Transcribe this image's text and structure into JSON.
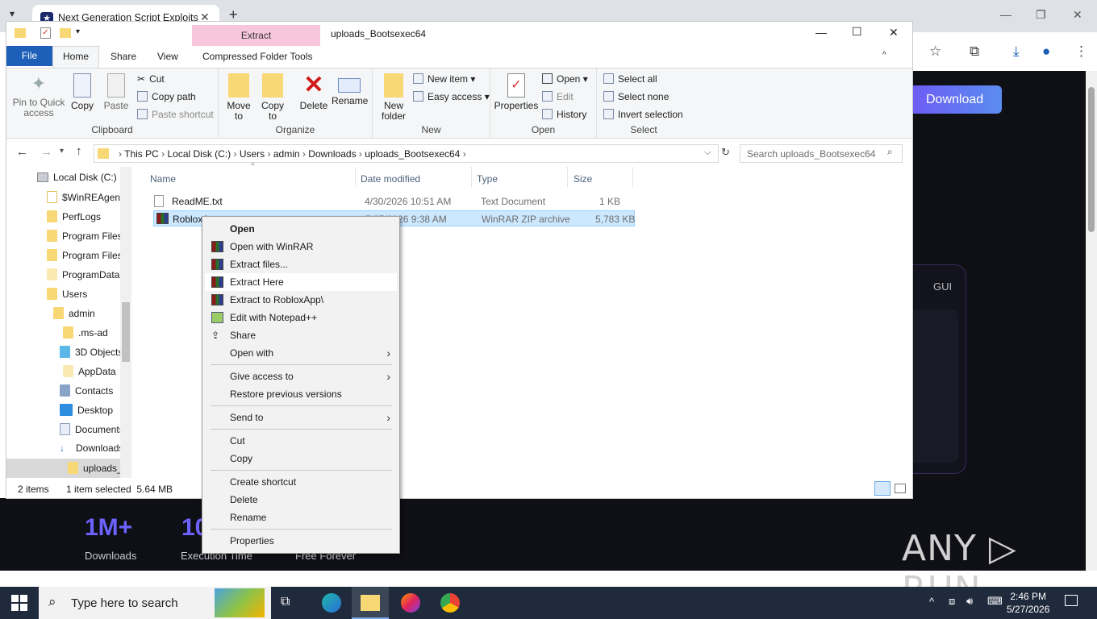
{
  "browser": {
    "tab_title": "Next Generation Script Exploits",
    "tab_close": "✕",
    "new_tab": "+",
    "window_controls": [
      "—",
      "❐",
      "✕"
    ],
    "toolbar_icons": [
      "help-icon",
      "star-icon",
      "extensions-icon",
      "download-icon",
      "profile-icon",
      "menu-icon"
    ]
  },
  "webpage": {
    "download_button": "Download",
    "gui_label": "GUI",
    "stats": [
      {
        "value": "1M+",
        "label": "Downloads"
      },
      {
        "value": "10",
        "label": "Execution Time"
      },
      {
        "value": "",
        "label": "Free Forever"
      }
    ],
    "watermark": "ANY RUN"
  },
  "explorer": {
    "title": "uploads_Bootsexec64",
    "context_tab": "Extract",
    "window_controls": [
      "—",
      "☐",
      "✕"
    ],
    "ribbon_tabs": [
      "File",
      "Home",
      "Share",
      "View",
      "Compressed Folder Tools"
    ],
    "clipboard": {
      "label": "Clipboard",
      "pin": "Pin to Quick access",
      "copy": "Copy",
      "paste": "Paste",
      "cut": "Cut",
      "copy_path": "Copy path",
      "paste_shortcut": "Paste shortcut"
    },
    "organize": {
      "label": "Organize",
      "move_to": "Move to",
      "copy_to": "Copy to",
      "delete": "Delete",
      "rename": "Rename"
    },
    "new": {
      "label": "New",
      "new_folder": "New folder",
      "new_item": "New item",
      "easy_access": "Easy access"
    },
    "open": {
      "label": "Open",
      "properties": "Properties",
      "open": "Open",
      "edit": "Edit",
      "history": "History"
    },
    "select": {
      "label": "Select",
      "select_all": "Select all",
      "select_none": "Select none",
      "invert": "Invert selection"
    },
    "breadcrumb": [
      "This PC",
      "Local Disk (C:)",
      "Users",
      "admin",
      "Downloads",
      "uploads_Bootsexec64"
    ],
    "search_placeholder": "Search uploads_Bootsexec64",
    "nav_items": [
      "Local Disk (C:)",
      "$WinREAgent",
      "PerfLogs",
      "Program Files",
      "Program Files",
      "ProgramData",
      "Users",
      "admin",
      ".ms-ad",
      "3D Objects",
      "AppData",
      "Contacts",
      "Desktop",
      "Documents",
      "Downloads",
      "uploads_"
    ],
    "columns": [
      "Name",
      "Date modified",
      "Type",
      "Size"
    ],
    "files": [
      {
        "name": "ReadME.txt",
        "date": "4/30/2026 10:51 AM",
        "type": "Text Document",
        "size": "1 KB"
      },
      {
        "name": "RobloxA",
        "date": "5/27/2026 9:38 AM",
        "type": "WinRAR ZIP archive",
        "size": "5,783 KB"
      }
    ],
    "status": {
      "items": "2 items",
      "selected": "1 item selected  5.64 MB"
    }
  },
  "context_menu": [
    {
      "label": "Open",
      "bold": true
    },
    {
      "label": "Open with WinRAR",
      "icon": "winrar-icon"
    },
    {
      "label": "Extract files...",
      "icon": "winrar-icon"
    },
    {
      "label": "Extract Here",
      "icon": "winrar-icon"
    },
    {
      "label": "Extract to RobloxApp\\",
      "icon": "winrar-icon"
    },
    {
      "label": "Edit with Notepad++",
      "icon": "notepadpp-icon"
    },
    {
      "label": "Share",
      "icon": "share-icon"
    },
    {
      "label": "Open with",
      "submenu": true
    },
    {
      "label": "Give access to",
      "submenu": true
    },
    {
      "label": "Restore previous versions"
    },
    {
      "label": "Send to",
      "submenu": true
    },
    {
      "label": "Cut"
    },
    {
      "label": "Copy"
    },
    {
      "label": "Create shortcut"
    },
    {
      "label": "Delete"
    },
    {
      "label": "Rename"
    },
    {
      "label": "Properties"
    }
  ],
  "taskbar": {
    "search_placeholder": "Type here to search",
    "time": "2:46 PM",
    "date": "5/27/2026"
  }
}
